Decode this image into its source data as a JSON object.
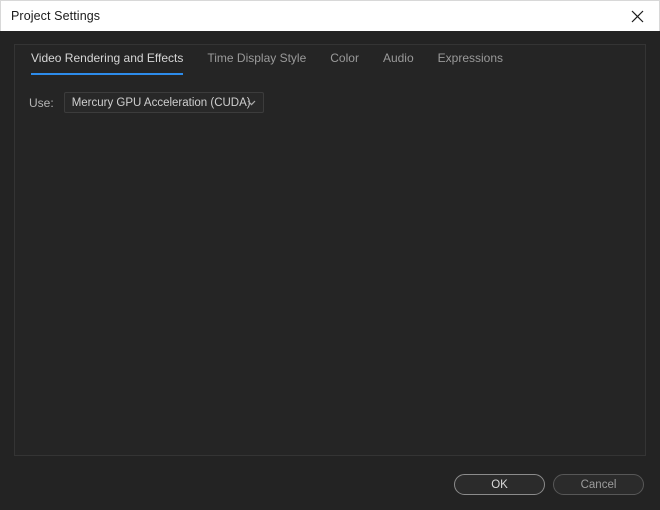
{
  "window": {
    "title": "Project Settings",
    "close_icon": "close-icon"
  },
  "tabs": [
    {
      "label": "Video Rendering and Effects",
      "active": true
    },
    {
      "label": "Time Display Style",
      "active": false
    },
    {
      "label": "Color",
      "active": false
    },
    {
      "label": "Audio",
      "active": false
    },
    {
      "label": "Expressions",
      "active": false
    }
  ],
  "settings": {
    "use_label": "Use:",
    "renderer": {
      "value": "Mercury GPU Acceleration (CUDA)",
      "arrow_icon": "chevron-down-icon"
    }
  },
  "footer": {
    "ok_label": "OK",
    "cancel_label": "Cancel"
  },
  "colors": {
    "accent": "#2d8ceb",
    "titlebar_bg": "#ffffff",
    "dialog_bg": "#232323",
    "panel_bg": "#252525"
  }
}
